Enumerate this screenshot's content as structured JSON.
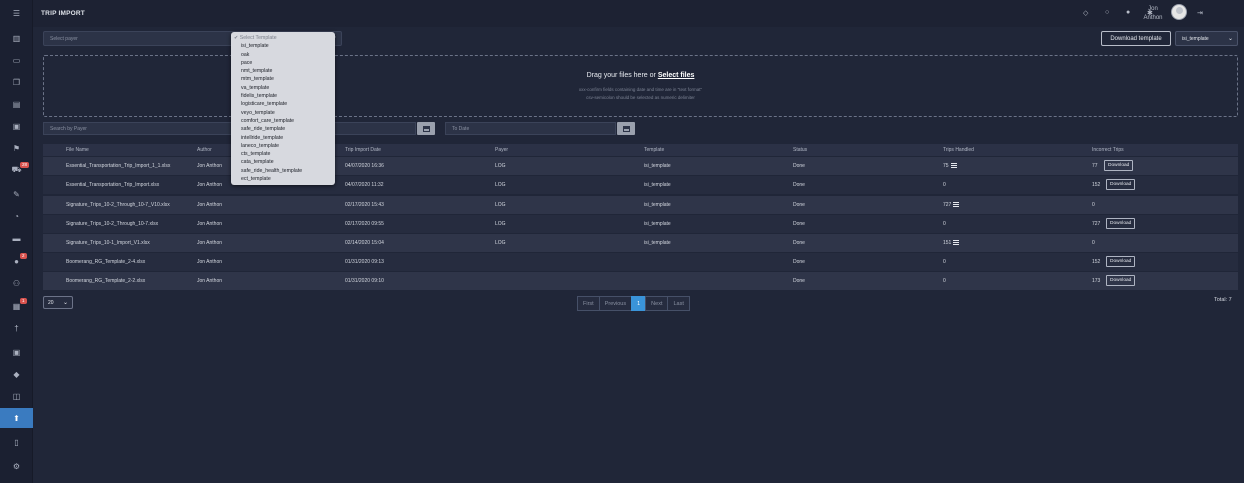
{
  "header": {
    "title": "TRIP IMPORT",
    "user_first": "Jon",
    "user_last": "Anthon"
  },
  "payer": {
    "placeholder": "Select payer"
  },
  "template_dropdown": {
    "placeholder": "Select Template",
    "options": [
      "isi_template",
      "oak",
      "pace",
      "nmt_template",
      "mtm_template",
      "va_template",
      "fidelis_template",
      "logisticare_template",
      "veyo_template",
      "comfort_care_template",
      "safe_ride_template",
      "intellride_template",
      "laneco_template",
      "cts_template",
      "cata_template",
      "safe_ride_health_template",
      "ect_template"
    ]
  },
  "toolbar": {
    "download_template_label": "Download template",
    "template_selected": "isi_template"
  },
  "dropzone": {
    "prefix": "Drag your files here or",
    "link": "Select files",
    "hint1": "xxx-confirm fields containing date and time are in \"text format\"",
    "hint2": "csv-semicolon should be selected as numeric delimiter"
  },
  "filters": {
    "payer_placeholder": "Search by Payer",
    "to_date_placeholder": "To Date"
  },
  "table": {
    "columns": [
      "File Name",
      "Author",
      "Trip Import Date",
      "Payer",
      "Template",
      "Status",
      "Trips Handled",
      "Incorrect Trips"
    ],
    "rows": [
      {
        "file": "Essential_Transportation_Trip_Import_1_1.xlsx",
        "author": "Jon Anthon",
        "date": "04/07/2020 16:36",
        "payer": "LOG",
        "template": "isi_template",
        "status": "Done",
        "handled": "75",
        "incorrect": "77",
        "download": "Download"
      },
      {
        "file": "Essential_Transportation_Trip_Import.xlsx",
        "author": "Jon Anthon",
        "date": "04/07/2020 11:32",
        "payer": "LOG",
        "template": "isi_template",
        "status": "Done",
        "handled": "0",
        "incorrect": "152",
        "download": "Download"
      },
      {
        "file": "Signature_Trips_10-2_Through_10-7_V10.xlsx",
        "author": "Jon Anthon",
        "date": "02/17/2020 15:43",
        "payer": "LOG",
        "template": "isi_template",
        "status": "Done",
        "handled": "727",
        "incorrect": "0",
        "download": ""
      },
      {
        "file": "Signature_Trips_10-2_Through_10-7.xlsx",
        "author": "Jon Anthon",
        "date": "02/17/2020 09:55",
        "payer": "LOG",
        "template": "isi_template",
        "status": "Done",
        "handled": "0",
        "incorrect": "727",
        "download": "Download"
      },
      {
        "file": "Signature_Trips_10-1_Import_V1.xlsx",
        "author": "Jon Anthon",
        "date": "02/14/2020 15:04",
        "payer": "LOG",
        "template": "isi_template",
        "status": "Done",
        "handled": "151",
        "incorrect": "0",
        "download": ""
      },
      {
        "file": "Boomerang_RG_Template_2-4.xlsx",
        "author": "Jon Anthon",
        "date": "01/31/2020 09:13",
        "payer": "",
        "template": "",
        "status": "Done",
        "handled": "0",
        "incorrect": "152",
        "download": "Download"
      },
      {
        "file": "Boomerang_RG_Template_2-2.xlsx",
        "author": "Jon Anthon",
        "date": "01/31/2020 09:10",
        "payer": "",
        "template": "",
        "status": "Done",
        "handled": "0",
        "incorrect": "173",
        "download": "Download"
      }
    ]
  },
  "pagination": {
    "per_page": "20",
    "first": "First",
    "previous": "Previous",
    "current": "1",
    "next": "Next",
    "last": "Last",
    "total": "Total: 7"
  },
  "sidebar": {
    "badges": [
      "28",
      "2",
      "1"
    ]
  }
}
